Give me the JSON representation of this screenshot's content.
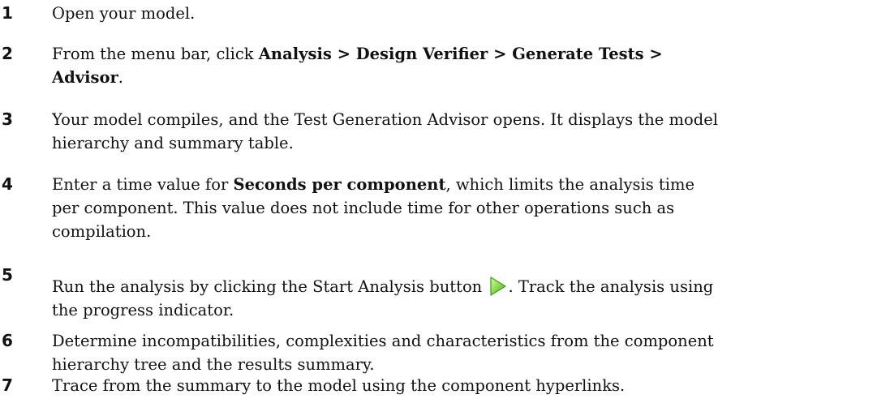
{
  "steps": [
    {
      "number": "1",
      "lines": [
        [
          "Open your model."
        ]
      ]
    },
    {
      "number": "2",
      "text_before": "From the menu bar, click ",
      "bold_path": "Analysis > Design Verifier > Generate Tests >",
      "bold_last": "Advisor",
      "text_after": "."
    },
    {
      "number": "3",
      "line1": "Your model compiles, and the Test Generation Advisor opens. It displays the model",
      "line2": "hierarchy and summary table."
    },
    {
      "number": "4",
      "text_before": "Enter a time value for ",
      "bold": "Seconds per component",
      "line1_after": ", which limits the analysis time",
      "line2": "per component. This value does not include time for other operations such as",
      "line3": "compilation."
    },
    {
      "number": "5",
      "text_before": "Run the analysis by clicking the Start Analysis button ",
      "icon": "play-icon",
      "text_after": ". Track the analysis using",
      "line2": "the progress indicator."
    },
    {
      "number": "6",
      "line1": "Determine incompatibilities, complexities and characteristics from the component",
      "line2": "hierarchy tree and the results summary."
    },
    {
      "number": "7",
      "line1": "Trace from the summary to the model using the component hyperlinks."
    }
  ],
  "colors": {
    "text": "#111111",
    "icon_green_light": "#b8f06a",
    "icon_green_dark": "#3fa81c"
  }
}
